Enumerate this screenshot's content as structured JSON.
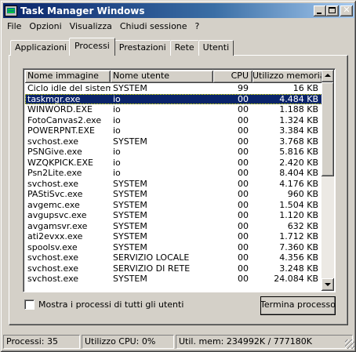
{
  "window": {
    "title": "Task Manager Windows"
  },
  "menu": [
    "File",
    "Opzioni",
    "Visualizza",
    "Chiudi sessione",
    "?"
  ],
  "tabs": [
    "Applicazioni",
    "Processi",
    "Prestazioni",
    "Rete",
    "Utenti"
  ],
  "active_tab": "Processi",
  "table": {
    "columns": [
      "Nome immagine",
      "Nome utente",
      "CPU",
      "Utilizzo memoria"
    ],
    "rows": [
      [
        "Ciclo idle del sistema",
        "SYSTEM",
        "99",
        "16 KB"
      ],
      [
        "taskmgr.exe",
        "io",
        "00",
        "4.484 KB"
      ],
      [
        "WINWORD.EXE",
        "io",
        "00",
        "1.188 KB"
      ],
      [
        "FotoCanvas2.exe",
        "io",
        "00",
        "1.324 KB"
      ],
      [
        "POWERPNT.EXE",
        "io",
        "00",
        "3.384 KB"
      ],
      [
        "svchost.exe",
        "SYSTEM",
        "00",
        "3.768 KB"
      ],
      [
        "PSNGive.exe",
        "io",
        "00",
        "5.816 KB"
      ],
      [
        "WZQKPICK.EXE",
        "io",
        "00",
        "2.420 KB"
      ],
      [
        "Psn2Lite.exe",
        "io",
        "00",
        "8.404 KB"
      ],
      [
        "svchost.exe",
        "SYSTEM",
        "00",
        "4.176 KB"
      ],
      [
        "PAStiSvc.exe",
        "SYSTEM",
        "00",
        "960 KB"
      ],
      [
        "avgemc.exe",
        "SYSTEM",
        "00",
        "1.504 KB"
      ],
      [
        "avgupsvc.exe",
        "SYSTEM",
        "00",
        "1.120 KB"
      ],
      [
        "avgamsvr.exe",
        "SYSTEM",
        "00",
        "632 KB"
      ],
      [
        "ati2evxx.exe",
        "SYSTEM",
        "00",
        "1.712 KB"
      ],
      [
        "spoolsv.exe",
        "SYSTEM",
        "00",
        "7.360 KB"
      ],
      [
        "svchost.exe",
        "SERVIZIO LOCALE",
        "00",
        "4.356 KB"
      ],
      [
        "svchost.exe",
        "SERVIZIO DI RETE",
        "00",
        "3.248 KB"
      ],
      [
        "svchost.exe",
        "SYSTEM",
        "00",
        "24.084 KB"
      ]
    ],
    "selected_row": 1
  },
  "show_all_label": "Mostra i processi di tutti gli utenti",
  "end_process_label": "Termina processo",
  "status": {
    "processes": "Processi: 35",
    "cpu": "Utilizzo CPU: 0%",
    "memory": "Util. mem: 234992K / 777180K"
  },
  "icons": {
    "app": "task-manager-icon",
    "minimize": "minimize-icon",
    "maximize": "maximize-icon",
    "close": "close-icon"
  },
  "colors": {
    "title_start": "#0a246a",
    "title_end": "#a6caf0",
    "selection": "#0a246a",
    "face": "#d4d0c8"
  }
}
